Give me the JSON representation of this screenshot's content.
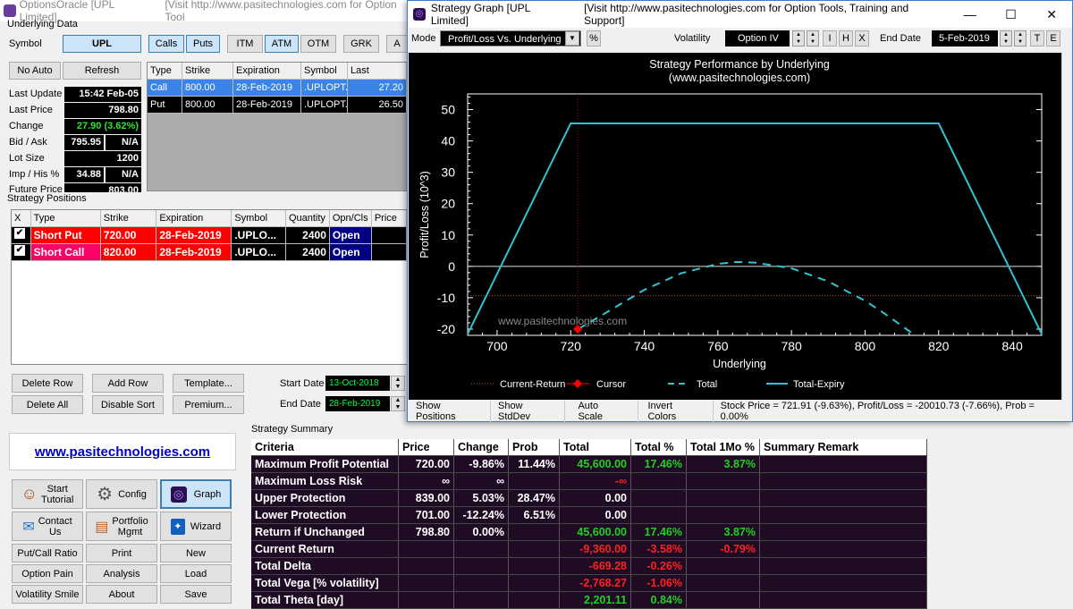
{
  "main": {
    "title": "OptionsOracle [UPL Limited]",
    "visit_text": "[Visit  http://www.pasitechnologies.com  for Option Tool",
    "underlying_header": "Underlying Data",
    "symbol_label": "Symbol",
    "symbol_value": "UPL",
    "toggles": [
      "Calls",
      "Puts",
      "ITM",
      "ATM",
      "OTM",
      "GRK",
      "A"
    ],
    "no_auto": "No Auto",
    "refresh": "Refresh",
    "fields": [
      {
        "label": "Last Update",
        "value": "15:42 Feb-05"
      },
      {
        "label": "Last Price",
        "value": "798.80"
      },
      {
        "label": "Change",
        "value": "27.90 (3.62%)"
      },
      {
        "label": "Bid / Ask",
        "value": "795.95",
        "value2": "N/A"
      },
      {
        "label": "Lot Size",
        "value": "1200"
      },
      {
        "label": "Imp / His %",
        "value": "34.88",
        "value2": "N/A"
      },
      {
        "label": "Future Price",
        "value": "803.00"
      }
    ],
    "option_table": {
      "headers": [
        "Type",
        "Strike",
        "Expiration",
        "Symbol",
        "Last"
      ],
      "rows": [
        [
          "Call",
          "800.00",
          "28-Feb-2019",
          ".UPLOPT...",
          "27.20"
        ],
        [
          "Put",
          "800.00",
          "28-Feb-2019",
          ".UPLOPT...",
          "26.50"
        ]
      ]
    },
    "positions_header": "Strategy Positions",
    "positions_table": {
      "headers": [
        "X",
        "Type",
        "Strike",
        "Expiration",
        "Symbol",
        "Quantity",
        "Opn/Cls",
        "Price"
      ],
      "rows": [
        {
          "type": "Short Put",
          "strike": "720.00",
          "expiration": "28-Feb-2019",
          "symbol": ".UPLO...",
          "quantity": "2400",
          "opn": "Open",
          "color": "#ff0000"
        },
        {
          "type": "Short Call",
          "strike": "820.00",
          "expiration": "28-Feb-2019",
          "symbol": ".UPLO...",
          "quantity": "2400",
          "opn": "Open",
          "color": "#ff0066"
        }
      ]
    },
    "row_buttons": [
      "Delete Row",
      "Add Row",
      "Template...",
      "Delete All",
      "Disable Sort",
      "Premium..."
    ],
    "start_date_label": "Start Date",
    "start_date": "13-Oct-2018",
    "end_date_label": "End Date",
    "end_date": "28-Feb-2019",
    "website": "www.pasitechnologies.com",
    "big_buttons": [
      {
        "label": "Start\nTutorial",
        "icon": "person-icon"
      },
      {
        "label": "Config",
        "icon": "gear-icon"
      },
      {
        "label": "Graph",
        "icon": "graph-icon"
      },
      {
        "label": "Contact\nUs",
        "icon": "contact-icon"
      },
      {
        "label": "Portfolio\nMgmt",
        "icon": "portfolio-icon"
      },
      {
        "label": "Wizard",
        "icon": "wizard-icon"
      }
    ],
    "small_buttons": [
      "Put/Call Ratio",
      "Print",
      "New",
      "Option Pain",
      "Analysis",
      "Load",
      "Volatility Smile",
      "About",
      "Save"
    ],
    "summary_header": "Strategy Summary",
    "summary": {
      "headers": [
        "Criteria",
        "Price",
        "Change",
        "Prob",
        "Total",
        "Total %",
        "Total 1Mo %",
        "Summary Remark"
      ],
      "rows": [
        [
          "Maximum Profit Potential",
          "720.00",
          "-9.86%",
          "11.44%",
          "45,600.00",
          "17.46%",
          "3.87%",
          ""
        ],
        [
          "Maximum Loss Risk",
          "∞",
          "∞",
          "",
          "-∞",
          "",
          "",
          ""
        ],
        [
          "Upper Protection",
          "839.00",
          "5.03%",
          "28.47%",
          "0.00",
          "",
          "",
          ""
        ],
        [
          "Lower Protection",
          "701.00",
          "-12.24%",
          "6.51%",
          "0.00",
          "",
          "",
          ""
        ],
        [
          "Return if Unchanged",
          "798.80",
          "0.00%",
          "",
          "45,600.00",
          "17.46%",
          "3.87%",
          ""
        ],
        [
          "Current Return",
          "",
          "",
          "",
          "-9,360.00",
          "-3.58%",
          "-0.79%",
          ""
        ],
        [
          "Total Delta",
          "",
          "",
          "",
          "-669.28",
          "-0.26%",
          "",
          ""
        ],
        [
          "Total Vega [% volatility]",
          "",
          "",
          "",
          "-2,768.27",
          "-1.06%",
          "",
          ""
        ],
        [
          "Total Theta [day]",
          "",
          "",
          "",
          "2,201.11",
          "0.84%",
          "",
          ""
        ]
      ]
    }
  },
  "graph_window": {
    "title": "Strategy Graph [UPL Limited]",
    "visit_text": "[Visit  http://www.pasitechnologies.com  for Option Tools, Training and Support]",
    "mode_label": "Mode",
    "mode_value": "Profit/Loss Vs. Underlying",
    "percent_button": "%",
    "volatility_label": "Volatility",
    "volatility_value": "Option IV",
    "vol_buttons": [
      "I",
      "H",
      "X"
    ],
    "end_date_label": "End Date",
    "end_date_value": "5-Feb-2019",
    "end_buttons": [
      "T",
      "E"
    ],
    "status": [
      "Show Positions",
      "Show StdDev",
      "Auto Scale",
      "Invert Colors",
      "Stock Price = 721.91 (-9.63%), Profit/Loss = -20010.73 (-7.66%), Prob = 0.00%"
    ]
  },
  "chart_data": {
    "type": "line",
    "title": "Strategy Performance by Underlying",
    "subtitle": "(www.pasitechnologies.com)",
    "watermark": "www.pasitechnologies.com",
    "xlabel": "Underlying",
    "ylabel": "Profit/Loss (10^3)",
    "xlim": [
      692,
      848
    ],
    "ylim": [
      -22,
      55
    ],
    "xticks": [
      700,
      720,
      740,
      760,
      780,
      800,
      820,
      840
    ],
    "yticks": [
      -20,
      -10,
      0,
      10,
      20,
      30,
      40,
      50
    ],
    "grid": false,
    "legend_position": "bottom",
    "series": [
      {
        "name": "Total-Expiry",
        "style": "solid",
        "color": "#2fc4d4",
        "x": [
          692,
          720,
          820,
          848
        ],
        "y": [
          -21.6,
          45.6,
          45.6,
          -21.6
        ]
      },
      {
        "name": "Total",
        "style": "dashed",
        "color": "#2fc4d4",
        "x": [
          722,
          730,
          740,
          750,
          760,
          765,
          770,
          780,
          790,
          800,
          805,
          813
        ],
        "y": [
          -20,
          -14.5,
          -7.5,
          -2.2,
          0.8,
          1.4,
          1.2,
          -0.6,
          -4.8,
          -11,
          -14.8,
          -21.5
        ]
      }
    ],
    "current_return": {
      "name": "Current-Return",
      "y": -9.36,
      "color": "#c05010"
    },
    "cursor": {
      "name": "Cursor",
      "x": 721.91,
      "y": -20.01,
      "color": "#ff0000"
    },
    "legend": [
      "Current-Return",
      "Cursor",
      "Total",
      "Total-Expiry"
    ]
  }
}
